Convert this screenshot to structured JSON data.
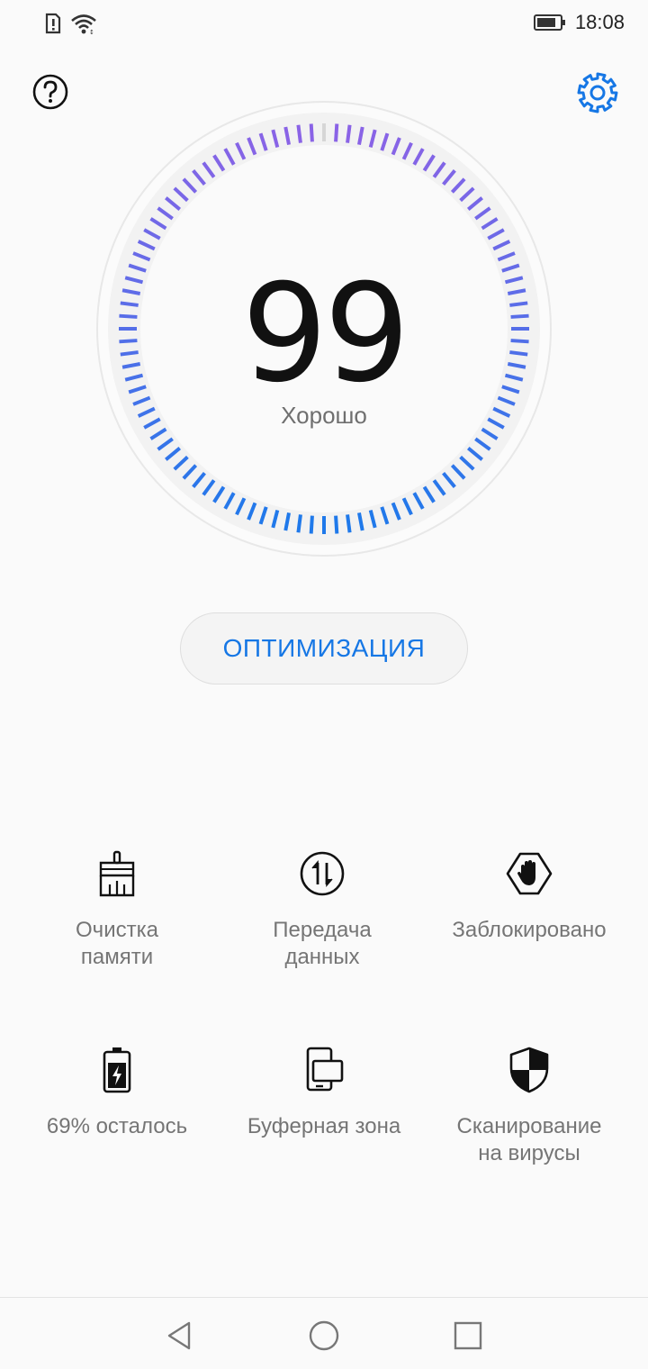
{
  "status_bar": {
    "time": "18:08",
    "icons": [
      "sim-alert-icon",
      "wifi-icon",
      "battery-icon"
    ]
  },
  "header": {
    "help_icon": "question-circle-icon",
    "settings_icon": "gear-icon",
    "accent_color": "#1677e5"
  },
  "score": {
    "value": "99",
    "status": "Хорошо",
    "level_fraction": 0.99,
    "gradient_colors": [
      "#8a63e6",
      "#1f79ea"
    ]
  },
  "optimize_button": {
    "label": "ОПТИМИЗАЦИЯ"
  },
  "tiles": [
    {
      "label": "Очистка\nпамяти",
      "icon": "broom-icon"
    },
    {
      "label": "Передача\nданных",
      "icon": "data-transfer-icon"
    },
    {
      "label": "Заблокировано",
      "icon": "block-hand-icon"
    },
    {
      "label": "69% осталось",
      "icon": "battery-charging-icon"
    },
    {
      "label": "Буферная зона",
      "icon": "dual-window-icon"
    },
    {
      "label": "Сканирование\nна вирусы",
      "icon": "shield-icon"
    }
  ],
  "nav_bar": {
    "buttons": [
      "back-icon",
      "home-icon",
      "recents-icon"
    ]
  }
}
